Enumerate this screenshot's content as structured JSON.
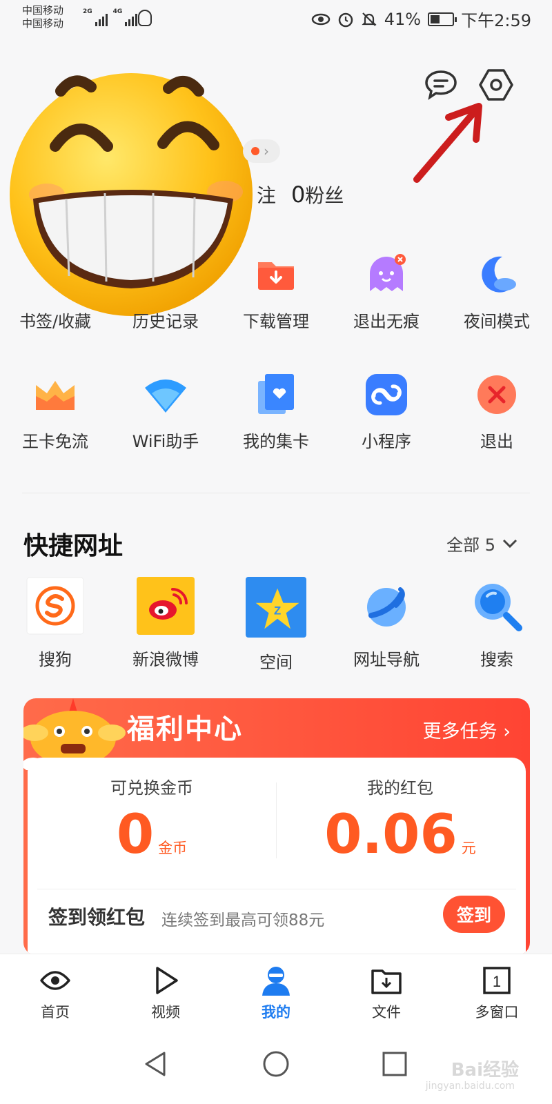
{
  "status_bar": {
    "carrier_1": "中国移动",
    "carrier_2": "中国移动",
    "network_1": "2G",
    "network_2": "4G",
    "battery": "41%",
    "time": "下午2:59"
  },
  "profile": {
    "following_suffix": "注",
    "followers_count": "0",
    "followers_label": "粉丝"
  },
  "grid_row1": [
    {
      "label": "书签/收藏",
      "icon": "bookmark-icon"
    },
    {
      "label": "历史记录",
      "icon": "history-icon"
    },
    {
      "label": "下载管理",
      "icon": "download-folder-icon"
    },
    {
      "label": "退出无痕",
      "icon": "ghost-icon"
    },
    {
      "label": "夜间模式",
      "icon": "moon-icon"
    }
  ],
  "grid_row2": [
    {
      "label": "王卡免流",
      "icon": "crown-icon"
    },
    {
      "label": "WiFi助手",
      "icon": "wifi-icon"
    },
    {
      "label": "我的集卡",
      "icon": "heart-card-icon"
    },
    {
      "label": "小程序",
      "icon": "mini-program-icon"
    },
    {
      "label": "退出",
      "icon": "exit-icon"
    }
  ],
  "quick_links": {
    "title": "快捷网址",
    "all_label": "全部 5",
    "items": [
      {
        "label": "搜狗",
        "icon": "sogou-icon"
      },
      {
        "label": "新浪微博",
        "icon": "weibo-icon"
      },
      {
        "label": "空间",
        "icon": "qzone-icon"
      },
      {
        "label": "网址导航",
        "icon": "planet-icon"
      },
      {
        "label": "搜索",
        "icon": "search-icon"
      }
    ]
  },
  "welfare": {
    "title": "福利中心",
    "more": "更多任务 ›",
    "coins_caption": "可兑换金币",
    "coins_value": "0",
    "coins_unit": "金币",
    "redpacket_caption": "我的红包",
    "redpacket_value": "0.06",
    "redpacket_unit": "元",
    "sign_title": "签到领红包",
    "sign_sub": "连续签到最高可领88元",
    "sign_button": "签到"
  },
  "bottom_nav": [
    {
      "label": "首页",
      "icon": "eye-icon",
      "active": false
    },
    {
      "label": "视频",
      "icon": "play-icon",
      "active": false
    },
    {
      "label": "我的",
      "icon": "person-icon",
      "active": true
    },
    {
      "label": "文件",
      "icon": "file-download-icon",
      "active": false
    },
    {
      "label": "多窗口",
      "icon": "windows-icon",
      "active": false
    }
  ],
  "window_count": "1",
  "watermark": {
    "main": "Bai经验",
    "sub": "jingyan.baidu.com"
  },
  "colors": {
    "accent": "#1e7cf0",
    "welfare": "#ff5233",
    "value": "#ff5a22"
  }
}
